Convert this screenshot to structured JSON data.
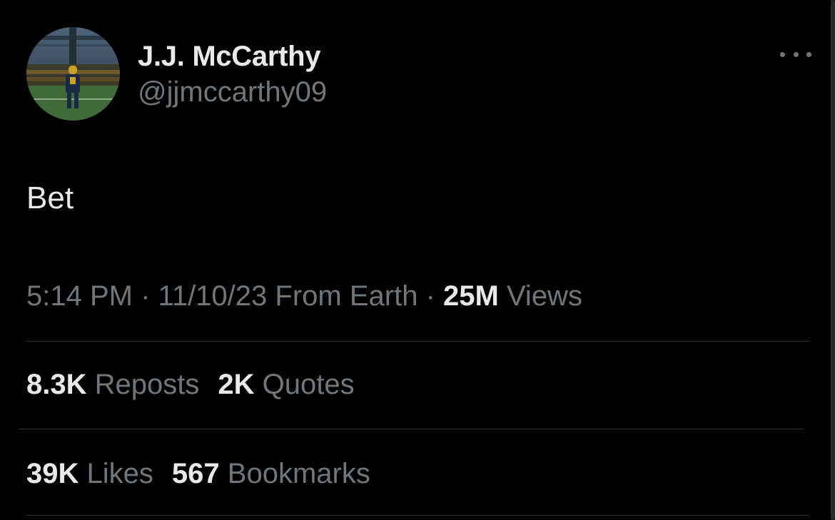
{
  "author": {
    "display_name": "J.J. McCarthy",
    "handle": "@jjmccarthy09"
  },
  "tweet": {
    "text": "Bet"
  },
  "meta": {
    "time": "5:14 PM",
    "separator": "·",
    "date": "11/10/23",
    "source": "From Earth",
    "views_count": "25M",
    "views_label": "Views"
  },
  "stats": {
    "reposts_count": "8.3K",
    "reposts_label": "Reposts",
    "quotes_count": "2K",
    "quotes_label": "Quotes",
    "likes_count": "39K",
    "likes_label": "Likes",
    "bookmarks_count": "567",
    "bookmarks_label": "Bookmarks"
  },
  "icons": {
    "more": "more-horizontal-icon"
  },
  "colors": {
    "background": "#000000",
    "primary_text": "#e7e9ea",
    "secondary_text": "#71767b",
    "divider": "#2f3336"
  }
}
